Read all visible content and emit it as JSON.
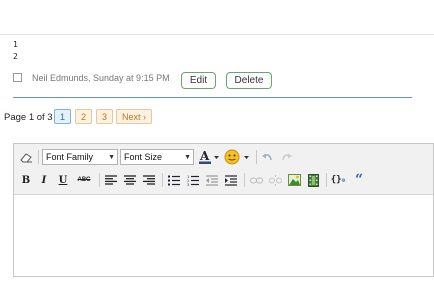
{
  "code_lines": [
    "1",
    "2"
  ],
  "comment": {
    "meta": "Neil Edmunds, Sunday at 9:15 PM",
    "edit_label": "Edit",
    "delete_label": "Delete"
  },
  "pager": {
    "label": "Page 1 of 3",
    "pages": [
      "1",
      "2",
      "3"
    ],
    "current": "1",
    "next_label": "Next ›"
  },
  "editor": {
    "font_family": "Font Family",
    "font_size": "Font Size",
    "icons": [
      "eraser-icon",
      "font-color-icon",
      "emoticon-icon",
      "undo-icon",
      "redo-icon",
      "bold-icon",
      "italic-icon",
      "underline-icon",
      "strikethrough-icon",
      "align-left-icon",
      "align-center-icon",
      "align-right-icon",
      "bullet-list-icon",
      "numbered-list-icon",
      "outdent-icon",
      "indent-icon",
      "link-icon",
      "unlink-icon",
      "image-icon",
      "media-icon",
      "code-icon",
      "quote-icon"
    ],
    "body_text": ""
  },
  "colors": {
    "button_border": "#6aa56a",
    "separator": "#5f9aa0",
    "page_current_bg": "#e3f1fb",
    "page_other_bg": "#fdf1e2"
  }
}
